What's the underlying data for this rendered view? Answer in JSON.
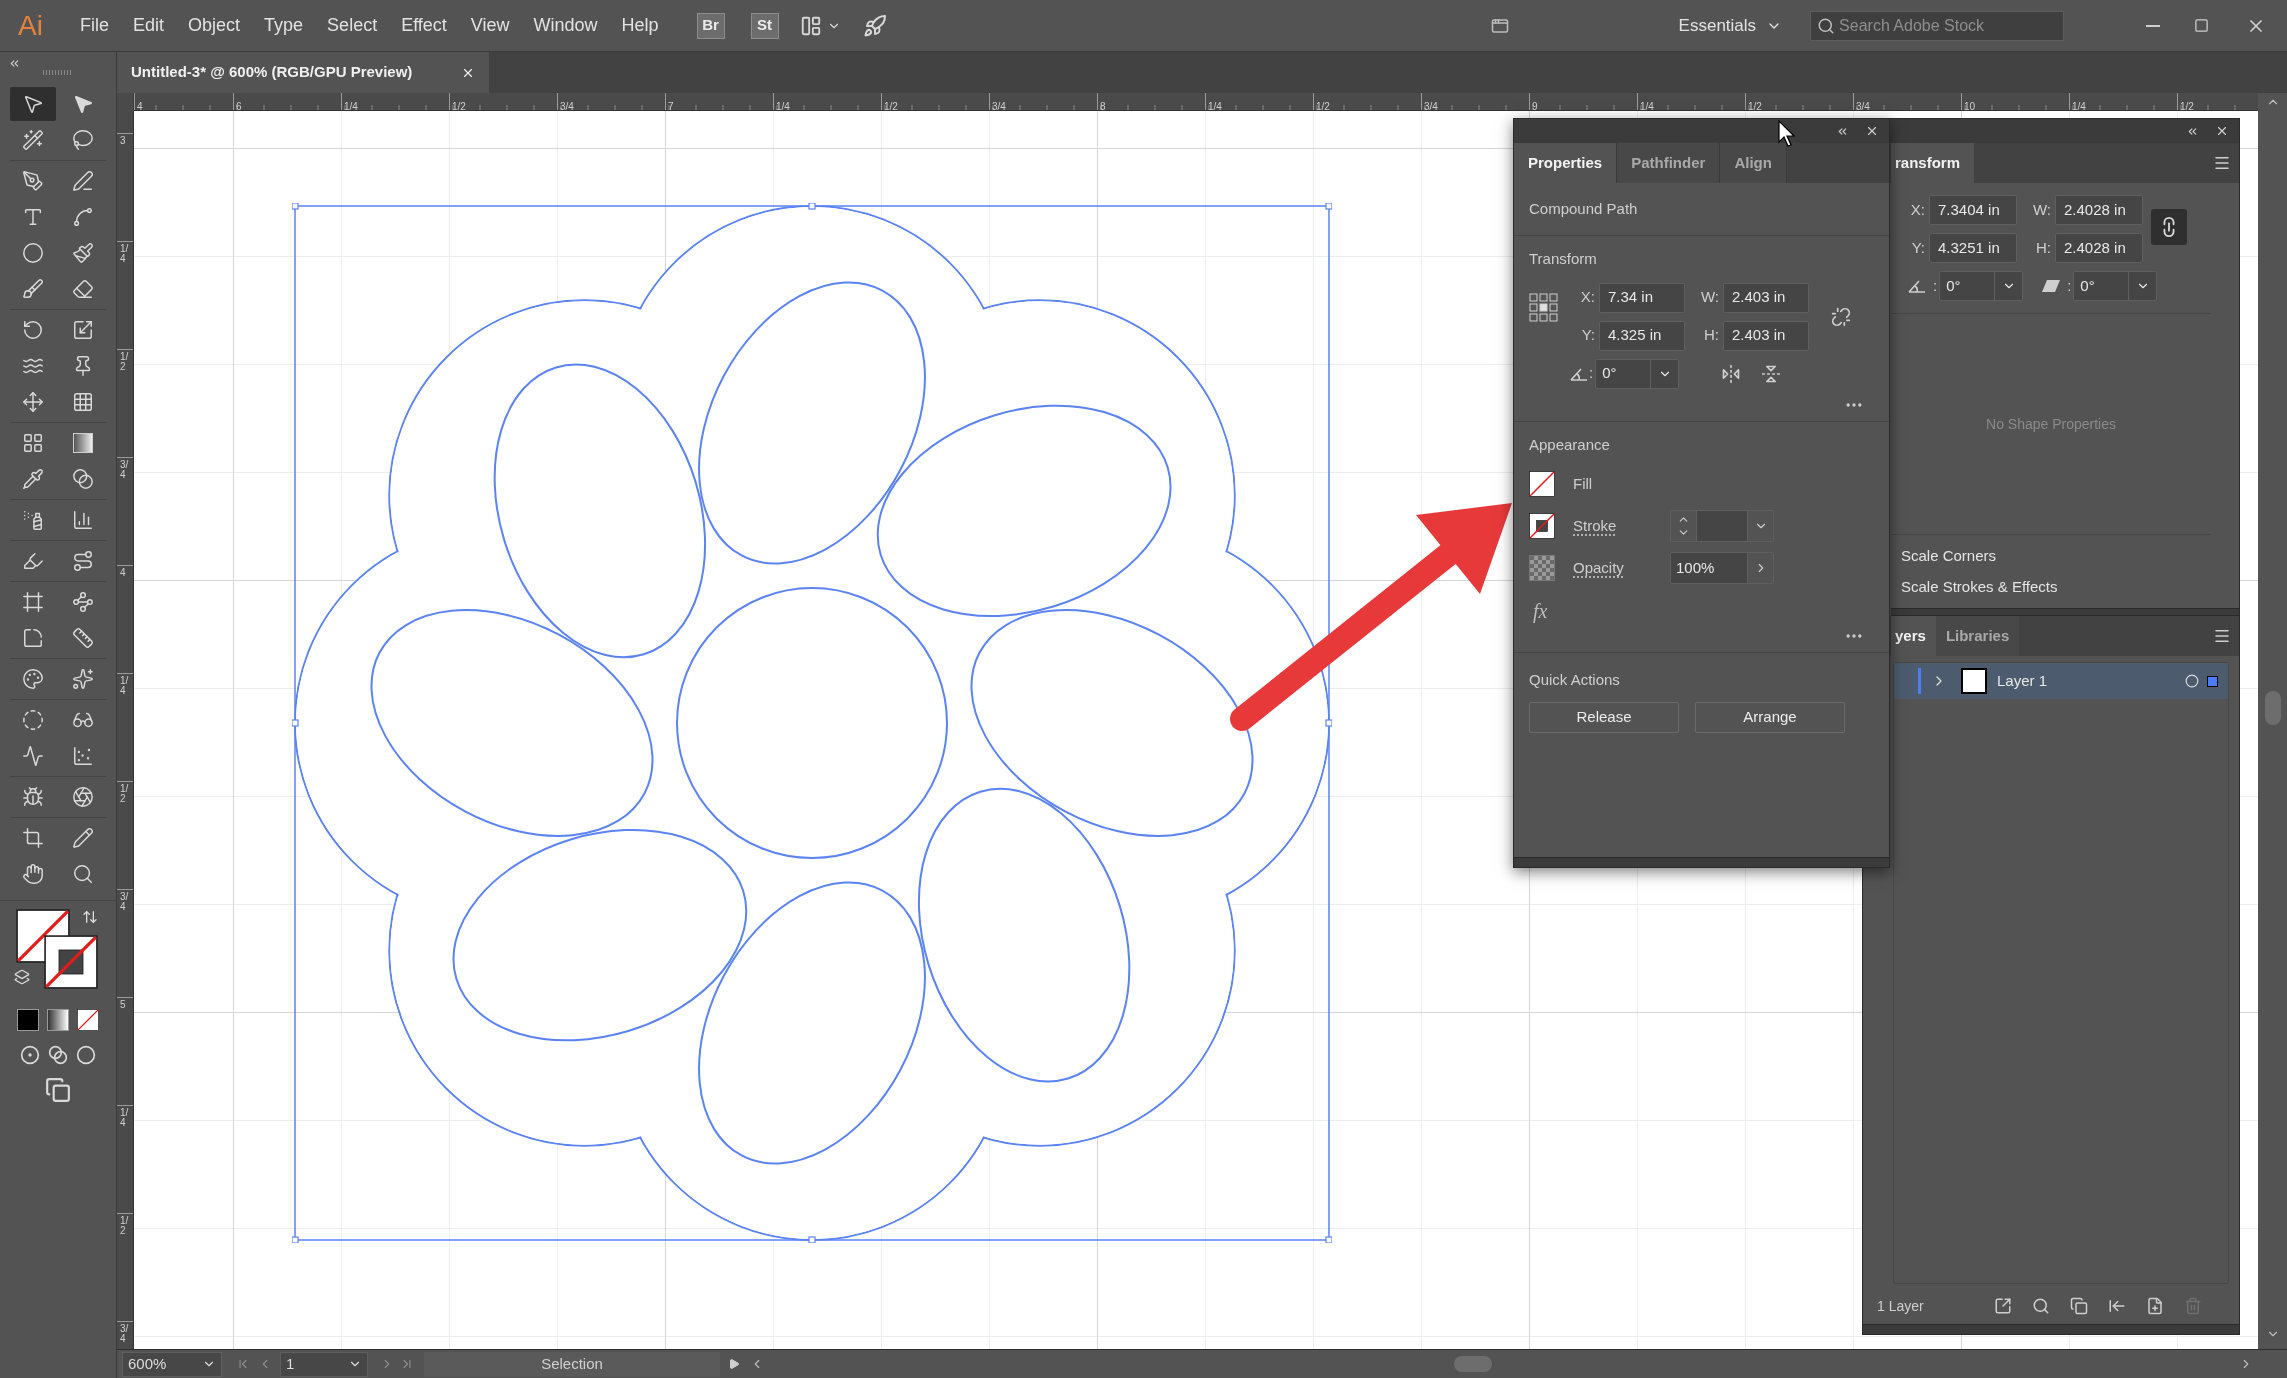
{
  "menu_bar": {
    "logo": "Ai",
    "menus": [
      "File",
      "Edit",
      "Object",
      "Type",
      "Select",
      "Effect",
      "View",
      "Window",
      "Help"
    ],
    "bridge_button": "Br",
    "stock_button": "St",
    "workspace": "Essentials",
    "search": {
      "placeholder": "Search Adobe Stock"
    }
  },
  "document_tab": {
    "title": "Untitled-3* @ 600% (RGB/GPU Preview)",
    "selected": true
  },
  "toolbar": {
    "tool_groups": [
      {
        "tools": [
          {
            "kind": "selection",
            "selected": true
          },
          {
            "kind": "direct_selection",
            "selected": false
          },
          {
            "kind": "magic_wand",
            "selected": false
          },
          {
            "kind": "lasso",
            "selected": false
          }
        ]
      },
      {
        "tools": [
          {
            "kind": "pen",
            "selected": false
          },
          {
            "kind": "curvature",
            "selected": false
          },
          {
            "kind": "type",
            "selected": false
          },
          {
            "kind": "line",
            "selected": false
          },
          {
            "kind": "ellipse",
            "selected": false
          },
          {
            "kind": "paintbrush",
            "selected": false
          },
          {
            "kind": "blob_brush",
            "selected": false
          },
          {
            "kind": "eraser",
            "selected": false
          }
        ]
      },
      {
        "tools": [
          {
            "kind": "rotate",
            "selected": false
          },
          {
            "kind": "scale",
            "selected": false
          },
          {
            "kind": "width",
            "selected": false
          },
          {
            "kind": "puppet_warp",
            "selected": false
          },
          {
            "kind": "free_transform",
            "selected": false
          },
          {
            "kind": "perspective",
            "selected": false
          }
        ]
      },
      {
        "tools": [
          {
            "kind": "mesh",
            "selected": false
          },
          {
            "kind": "gradient",
            "selected": false
          },
          {
            "kind": "eyedropper",
            "selected": false
          },
          {
            "kind": "blend",
            "selected": false
          }
        ]
      },
      {
        "tools": [
          {
            "kind": "symbol_sprayer",
            "selected": false
          },
          {
            "kind": "column_graph",
            "selected": false
          }
        ]
      },
      {
        "tools": [
          {
            "kind": "live_paint",
            "selected": false
          },
          {
            "kind": "live_paint_selection",
            "selected": false
          }
        ]
      },
      {
        "tools": [
          {
            "kind": "artboard",
            "selected": false
          },
          {
            "kind": "curve_node",
            "selected": false
          },
          {
            "kind": "corner",
            "selected": false
          },
          {
            "kind": "ruler",
            "selected": false
          }
        ]
      },
      {
        "tools": [
          {
            "kind": "palette",
            "selected": false
          },
          {
            "kind": "texture",
            "selected": false
          }
        ]
      },
      {
        "tools": [
          {
            "kind": "circle_nodes",
            "selected": false
          },
          {
            "kind": "glasses",
            "selected": false
          },
          {
            "kind": "wave_line",
            "selected": false
          },
          {
            "kind": "scatter",
            "selected": false
          }
        ]
      },
      {
        "tools": [
          {
            "kind": "butterfly",
            "selected": false
          },
          {
            "kind": "spiral",
            "selected": false
          }
        ]
      },
      {
        "tools": [
          {
            "kind": "crop",
            "selected": false
          },
          {
            "kind": "pencil",
            "selected": false
          },
          {
            "kind": "hand",
            "selected": false
          },
          {
            "kind": "zoom",
            "selected": false
          }
        ]
      }
    ],
    "fill_none": true,
    "stroke_none": true
  },
  "rulers": {
    "horizontal": [
      "4",
      "6",
      "1/4",
      "1/2",
      "3/4",
      "7",
      "1/4",
      "1/2",
      "3/4",
      "8",
      "1/4",
      "1/2",
      "3/4",
      "9",
      "1/4",
      "1/2",
      "3/4",
      "10",
      "1/4",
      "1/2"
    ],
    "vertical": [
      "3",
      "1/4",
      "1/2",
      "3/4",
      "4",
      "1/4",
      "1/2",
      "3/4",
      "5",
      "1/4",
      "1/2",
      "3/4"
    ]
  },
  "properties_panel": {
    "tabs": [
      {
        "label": "Properties",
        "selected": true
      },
      {
        "label": "Pathfinder",
        "selected": false
      },
      {
        "label": "Align",
        "selected": false
      }
    ],
    "object_type": "Compound Path",
    "transform": {
      "title": "Transform",
      "fields": [
        {
          "label": "X:",
          "value": "7.34 in"
        },
        {
          "label": "W:",
          "value": "2.403 in"
        },
        {
          "label": "Y:",
          "value": "4.325 in"
        },
        {
          "label": "H:",
          "value": "2.403 in"
        }
      ],
      "angle": {
        "label": ":",
        "value": "0°"
      },
      "constrain_linked": false
    },
    "appearance": {
      "title": "Appearance",
      "rows": [
        {
          "kind": "fill",
          "label": "Fill"
        },
        {
          "kind": "stroke",
          "label": "Stroke"
        },
        {
          "kind": "opacity",
          "label": "Opacity",
          "value": "100%"
        }
      ],
      "effects_button": "fx"
    },
    "quick_actions": {
      "title": "Quick Actions",
      "buttons": [
        "Release",
        "Arrange"
      ]
    }
  },
  "transform_panel": {
    "tab": {
      "label": "ransform",
      "selected": true
    },
    "fields": [
      {
        "label": "X:",
        "value": "7.3404 in"
      },
      {
        "label": "W:",
        "value": "2.4028 in"
      },
      {
        "label": "Y:",
        "value": "4.3251 in"
      },
      {
        "label": "H:",
        "value": "2.4028 in"
      }
    ],
    "angle": {
      "label": ":",
      "value": "0°"
    },
    "shear": {
      "label": ":",
      "value": "0°"
    },
    "constrain_linked": true,
    "shape_message": "No Shape Properties",
    "options": [
      "Scale Corners",
      "Scale Strokes & Effects"
    ]
  },
  "layers_panel": {
    "tabs": [
      {
        "label": "yers",
        "selected": true
      },
      {
        "label": "Libraries",
        "selected": false
      }
    ],
    "layers": [
      {
        "name": "Layer 1",
        "selected": true,
        "color": "#4a7dff"
      }
    ],
    "count": "1 Layer"
  },
  "status_bar": {
    "zoom": "600%",
    "artboard": "1",
    "tool": "Selection"
  }
}
